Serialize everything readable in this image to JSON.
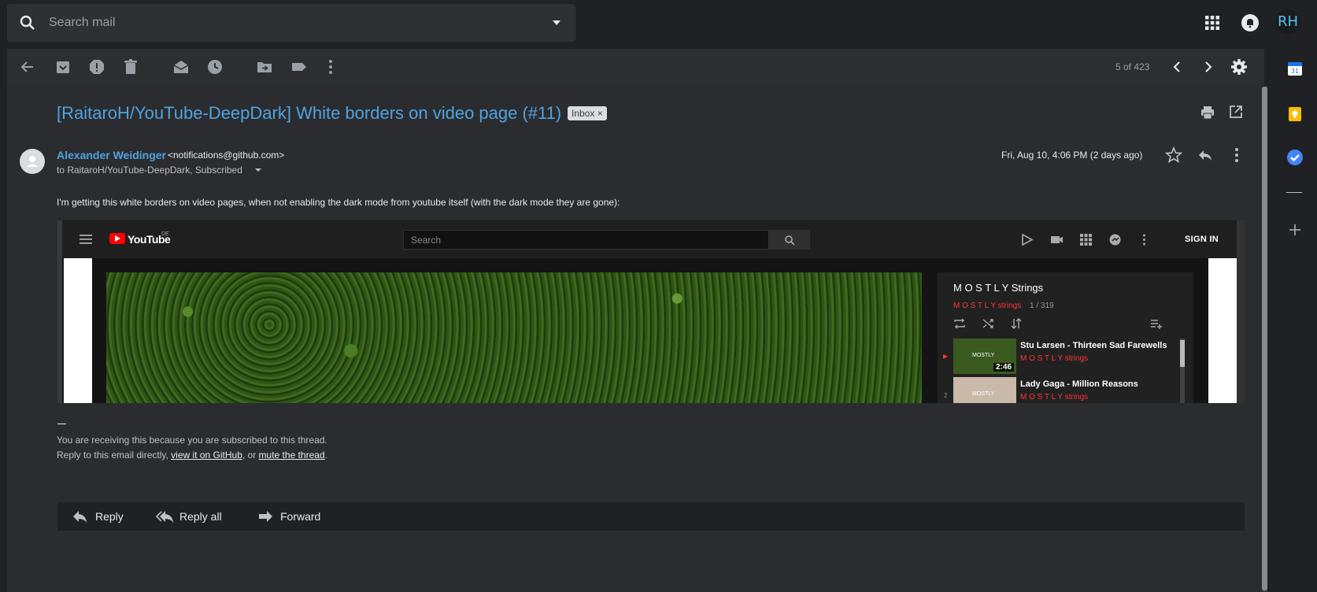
{
  "search": {
    "placeholder": "Search mail"
  },
  "top": {
    "avatar_initials": "RH"
  },
  "toolbar": {
    "count": "5 of 423"
  },
  "email": {
    "subject": "[RaitaroH/YouTube-DeepDark] White borders on video page (#11)",
    "label": "Inbox",
    "label_close": "×",
    "sender_name": "Alexander Weidinger",
    "sender_email": "<notifications@github.com>",
    "to": "to RaitaroH/YouTube-DeepDark, Subscribed",
    "date": "Fri, Aug 10, 4:06 PM (2 days ago)",
    "body": "I'm getting this white borders on video pages, when not enabling the dark mode from youtube itself (with the dark mode they are gone):",
    "footer_dash": "—",
    "footer_line1": "You are receiving this because you are subscribed to this thread.",
    "footer_line2_prefix": "Reply to this email directly, ",
    "footer_link1": "view it on GitHub",
    "footer_line2_mid": ", or ",
    "footer_link2": "mute the thread",
    "footer_line2_suffix": "."
  },
  "screenshot": {
    "logo_text": "YouTube",
    "logo_region": "DE",
    "search_placeholder": "Search",
    "signin": "SIGN IN",
    "playlist_title": "M O S T L Y Strings",
    "playlist_owner": "M O S T L Y strings",
    "playlist_count": "1 / 319",
    "items": [
      {
        "marker": "▶",
        "title": "Stu Larsen - Thirteen Sad Farewells",
        "channel": "M O S T L Y strings",
        "duration": "2:46",
        "thumb_label": "MOSTLY"
      },
      {
        "marker": "2",
        "title": "Lady Gaga - Million Reasons",
        "channel": "M O S T L Y strings",
        "duration": "",
        "thumb_label": "MOSTLY"
      }
    ]
  },
  "actions": {
    "reply": "Reply",
    "reply_all": "Reply all",
    "forward": "Forward"
  },
  "colors": {
    "accent": "#4fa3e0",
    "background": "#202124",
    "surface": "#2b2c2f",
    "youtube_red": "#ff0000"
  }
}
